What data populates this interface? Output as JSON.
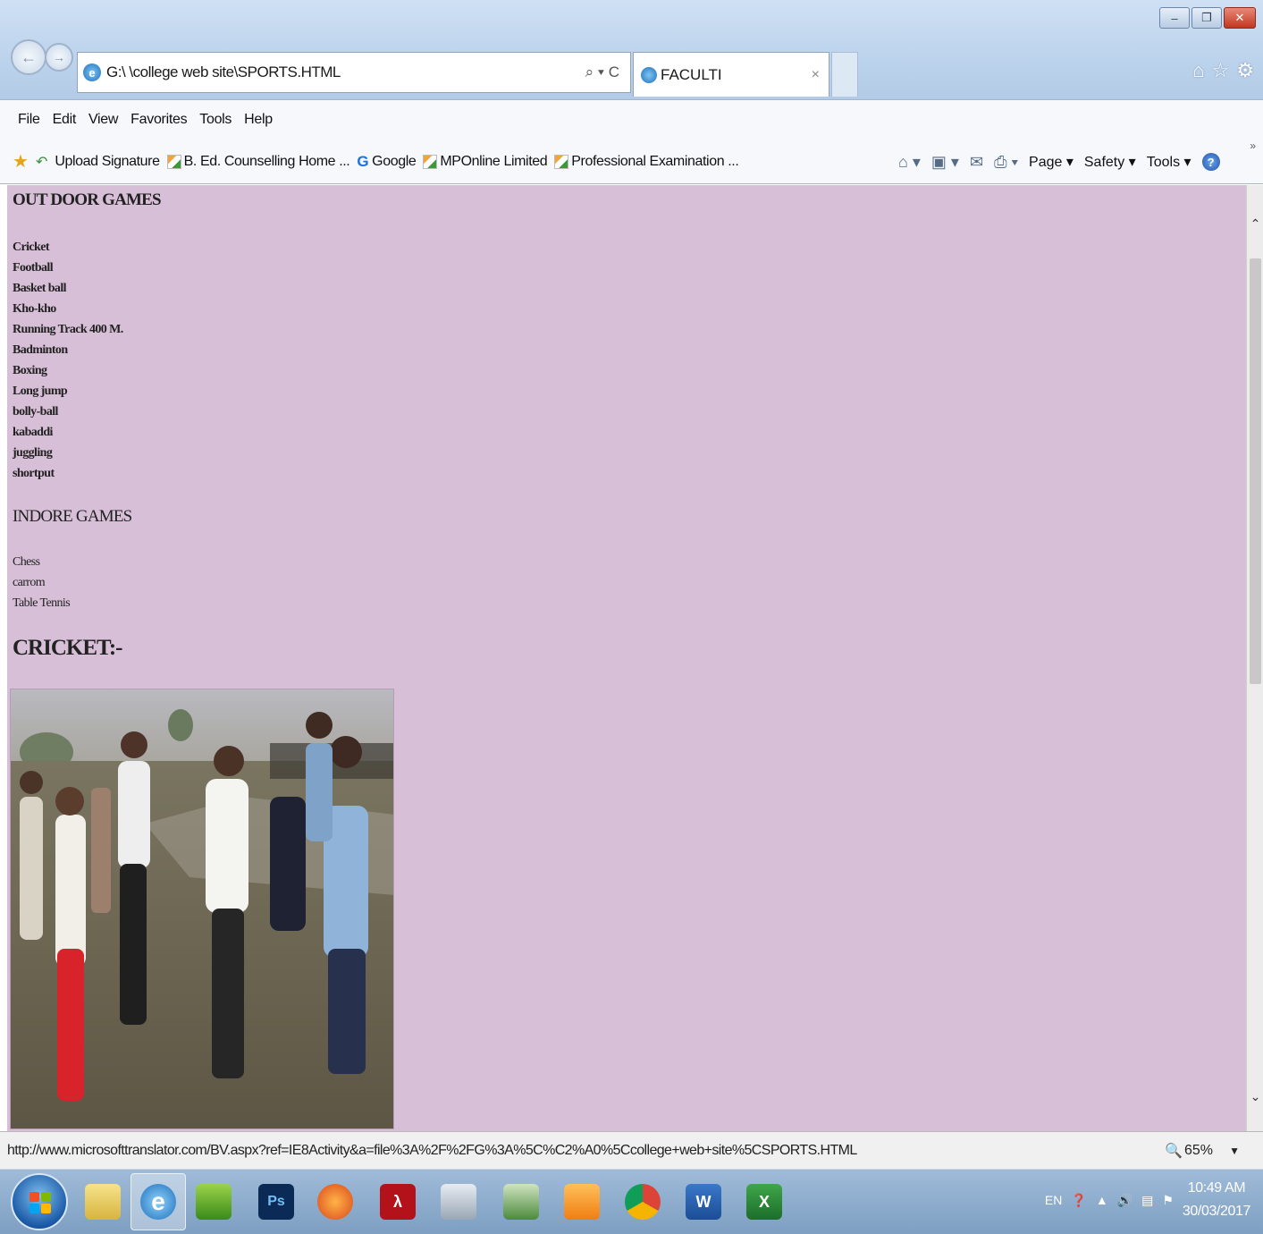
{
  "window": {
    "minimize_icon": "minimize-icon",
    "restore_icon": "restore-icon",
    "close_icon": "close-icon"
  },
  "address": {
    "url": "G:\\ \\college web site\\SPORTS.HTML",
    "tools": "⌕ ▾ C"
  },
  "tabs": [
    {
      "title": "FACULTI",
      "close": "×"
    }
  ],
  "menu": [
    "File",
    "Edit",
    "View",
    "Favorites",
    "Tools",
    "Help"
  ],
  "favorites": [
    {
      "label": "Upload Signature",
      "icon": "ie-page-icon"
    },
    {
      "label": "B. Ed. Counselling Home ...",
      "icon": "mponline-icon"
    },
    {
      "label": "Google",
      "icon": "google-icon"
    },
    {
      "label": "MPOnline Limited",
      "icon": "mponline-icon"
    },
    {
      "label": "Professional Examination ...",
      "icon": "mponline-icon"
    }
  ],
  "command_bar": {
    "page": "Page ▾",
    "safety": "Safety ▾",
    "tools": "Tools ▾",
    "help": "?"
  },
  "content": {
    "outdoor_heading": "OUT DOOR GAMES",
    "outdoor_games": [
      "Cricket",
      "Football",
      "Basket ball",
      "Kho-kho",
      "Running Track 400 M.",
      "Badminton",
      "Boxing",
      "Long jump",
      "bolly-ball",
      "kabaddi",
      "juggling",
      "shortput"
    ],
    "indoor_heading": "INDORE GAMES",
    "indoor_games": [
      "Chess",
      "carrom",
      "Table Tennis"
    ],
    "cricket_heading": "CRICKET:-",
    "background_color": "#d8bfd8"
  },
  "status": {
    "url": "http://www.microsofttranslator.com/BV.aspx?ref=IE8Activity&a=file%3A%2F%2FG%3A%5C%C2%A0%5Ccollege+web+site%5CSPORTS.HTML",
    "zoom": "65%"
  },
  "taskbar": {
    "apps": [
      "explorer",
      "internet-explorer",
      "app-green",
      "photoshop",
      "firefox",
      "acrobat",
      "notepad",
      "shield-app",
      "uc-browser",
      "chrome",
      "word",
      "excel"
    ],
    "language": "EN",
    "time": "10:49 AM",
    "date": "30/03/2017"
  }
}
